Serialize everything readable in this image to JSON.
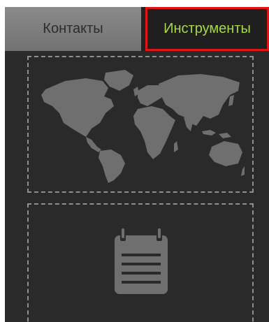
{
  "tabs": [
    {
      "label": "Контакты",
      "active": false
    },
    {
      "label": "Инструменты",
      "active": true
    }
  ],
  "colors": {
    "panel_background": "#2a2a2a",
    "inactive_tab": "#7d7d7d",
    "active_tab_text": "#a6d84a",
    "highlight_border": "#e01515",
    "icon_fill": "#6f6f6f",
    "card_border": "#8f8f8f"
  },
  "tools": [
    {
      "icon": "world-map-icon"
    },
    {
      "icon": "notepad-icon"
    }
  ]
}
